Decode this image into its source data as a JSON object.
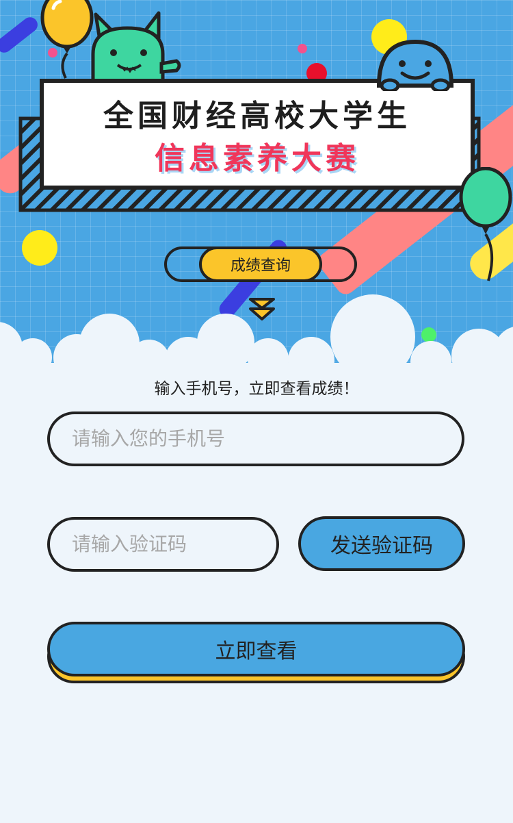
{
  "header": {
    "title_line1": "全国财经高校大学生",
    "title_line2": "信息素养大赛"
  },
  "tab": {
    "label": "成绩查询"
  },
  "form": {
    "prompt": "输入手机号，立即查看成绩！",
    "phone_placeholder": "请输入您的手机号",
    "code_placeholder": "请输入验证码",
    "send_code_label": "发送验证码",
    "submit_label": "立即查看"
  },
  "colors": {
    "sky": "#4aa6e3",
    "accent_yellow": "#fbc52a",
    "accent_pink": "#f0365a",
    "mascot_green": "#3ed6a0",
    "button_blue": "#49a7e1",
    "background": "#eef5fb"
  }
}
